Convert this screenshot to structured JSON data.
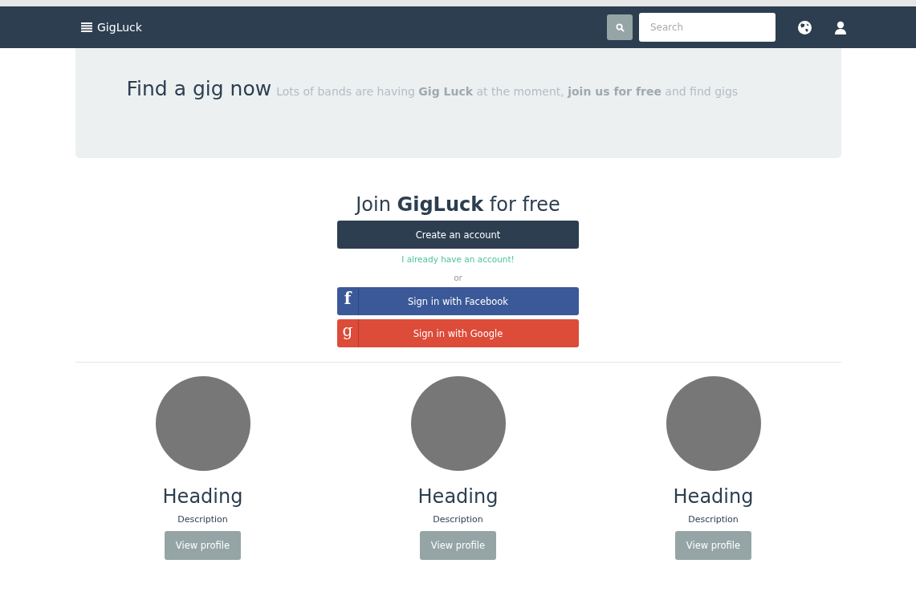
{
  "navbar": {
    "brand": "GigLuck",
    "search": {
      "placeholder": "Search"
    }
  },
  "jumbotron": {
    "title": "Find a gig now",
    "lead": "Lots of bands are having **Gig Luck** at the moment, **join us for free** and find gigs"
  },
  "join": {
    "heading": "Join **GigLuck** for free",
    "create_button": "Create an account",
    "login_link": "I already have an account!",
    "separator": "or",
    "social_buttons": [
      {
        "kind": "facebook",
        "glyph": "f",
        "label": "Sign in with Facebook"
      },
      {
        "kind": "google",
        "glyph": "g",
        "label": "Sign in with Google"
      }
    ]
  },
  "profiles": [
    {
      "heading": "Heading",
      "description": "Description",
      "button": "View profile"
    },
    {
      "heading": "Heading",
      "description": "Description",
      "button": "View profile"
    },
    {
      "heading": "Heading",
      "description": "Description",
      "button": "View profile"
    }
  ]
}
